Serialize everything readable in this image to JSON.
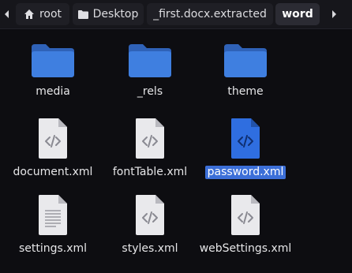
{
  "pathbar": {
    "crumbs": [
      {
        "label": "root",
        "icon": "home-icon"
      },
      {
        "label": "Desktop"
      },
      {
        "label": "_first.docx.extracted"
      },
      {
        "label": "word",
        "active": true
      }
    ]
  },
  "files": [
    {
      "name": "media",
      "type": "folder"
    },
    {
      "name": "_rels",
      "type": "folder"
    },
    {
      "name": "theme",
      "type": "folder"
    },
    {
      "name": "document.xml",
      "type": "code-file"
    },
    {
      "name": "fontTable.xml",
      "type": "code-file"
    },
    {
      "name": "password.xml",
      "type": "code-file",
      "selected": true
    },
    {
      "name": "settings.xml",
      "type": "text-file"
    },
    {
      "name": "styles.xml",
      "type": "code-file"
    },
    {
      "name": "webSettings.xml",
      "type": "code-file"
    }
  ],
  "colors": {
    "background": "#0d0d11",
    "folder": "#3f7fe0",
    "selection": "#3c6fd8",
    "file": "#e9e9ec"
  }
}
